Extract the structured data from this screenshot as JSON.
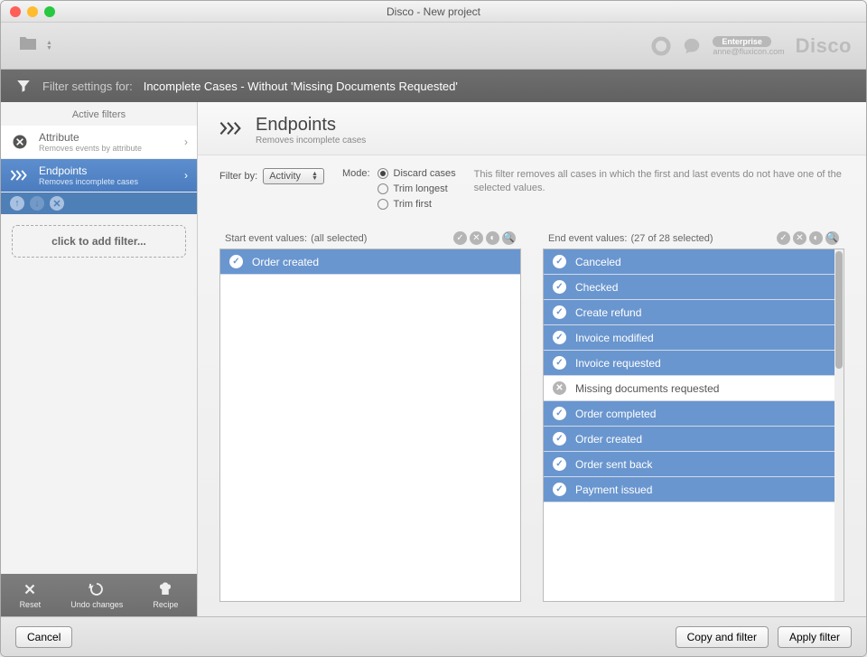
{
  "window_title": "Disco - New project",
  "toolbar": {
    "badge": "Enterprise",
    "email": "anne@fluxicon.com",
    "logo": "Disco"
  },
  "filterbar": {
    "label": "Filter settings for:",
    "name": "Incomplete Cases - Without 'Missing Documents Requested'"
  },
  "sidebar": {
    "header": "Active filters",
    "items": [
      {
        "name": "Attribute",
        "desc": "Removes events by attribute",
        "active": false
      },
      {
        "name": "Endpoints",
        "desc": "Removes incomplete cases",
        "active": true
      }
    ],
    "add": "click to add filter...",
    "bottom": {
      "reset": "Reset",
      "undo": "Undo changes",
      "recipe": "Recipe"
    }
  },
  "main": {
    "title": "Endpoints",
    "subtitle": "Removes incomplete cases",
    "filter_by_label": "Filter by:",
    "filter_by_value": "Activity",
    "mode_label": "Mode:",
    "modes": [
      {
        "label": "Discard cases",
        "selected": true
      },
      {
        "label": "Trim longest",
        "selected": false
      },
      {
        "label": "Trim first",
        "selected": false
      }
    ],
    "help": "This filter removes all cases in which the first and last events do not have one of the selected values."
  },
  "start_panel": {
    "label": "Start event values:",
    "status": "(all selected)",
    "rows": [
      {
        "label": "Order created",
        "selected": true
      }
    ]
  },
  "end_panel": {
    "label": "End event values:",
    "status": "(27 of 28 selected)",
    "rows": [
      {
        "label": "Canceled",
        "selected": true
      },
      {
        "label": "Checked",
        "selected": true
      },
      {
        "label": "Create refund",
        "selected": true
      },
      {
        "label": "Invoice modified",
        "selected": true
      },
      {
        "label": "Invoice requested",
        "selected": true
      },
      {
        "label": "Missing documents requested",
        "selected": false
      },
      {
        "label": "Order completed",
        "selected": true
      },
      {
        "label": "Order created",
        "selected": true
      },
      {
        "label": "Order sent back",
        "selected": true
      },
      {
        "label": "Payment issued",
        "selected": true
      }
    ]
  },
  "footer": {
    "cancel": "Cancel",
    "copy": "Copy and filter",
    "apply": "Apply filter"
  }
}
